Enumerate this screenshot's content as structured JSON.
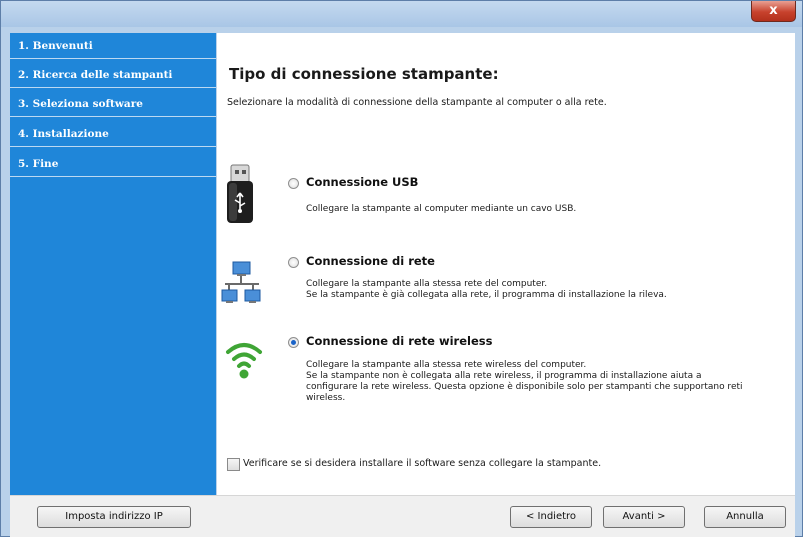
{
  "window": {
    "close_glyph": "x"
  },
  "sidebar": {
    "items": [
      {
        "label": "1. Benvenuti"
      },
      {
        "label": "2. Ricerca delle stampanti"
      },
      {
        "label": "3. Seleziona software"
      },
      {
        "label": "4. Installazione"
      },
      {
        "label": "5. Fine"
      }
    ]
  },
  "main": {
    "title": "Tipo di connessione stampante:",
    "subtitle": "Selezionare la modalità di connessione della stampante al computer o alla rete.",
    "options": [
      {
        "icon": "usb-drive-icon",
        "label": "Connessione USB",
        "selected": false,
        "desc": [
          "Collegare la stampante al computer mediante un cavo USB."
        ]
      },
      {
        "icon": "network-icon",
        "label": "Connessione di rete",
        "selected": false,
        "desc": [
          "Collegare la stampante alla stessa rete del computer.",
          "Se la stampante è già collegata alla rete, il programma di installazione la rileva."
        ]
      },
      {
        "icon": "wireless-icon",
        "label": "Connessione di rete wireless",
        "selected": true,
        "desc": [
          "Collegare la stampante alla stessa rete wireless del computer.",
          "Se la stampante non è collegata alla rete wireless, il programma di installazione aiuta a",
          "configurare la rete wireless. Questa opzione è disponibile solo per stampanti che supportano reti",
          "wireless."
        ]
      }
    ],
    "checkbox": {
      "checked": false,
      "label": "Verificare se si desidera installare il software senza collegare la stampante."
    }
  },
  "footer": {
    "ip_button": "Imposta indirizzo IP",
    "back_button": "< Indietro",
    "next_button": "Avanti >",
    "cancel_button": "Annulla"
  },
  "colors": {
    "sidebar": "#1f86d9",
    "radio_selected": "#1a63c8",
    "wifi_green": "#3fa535"
  }
}
